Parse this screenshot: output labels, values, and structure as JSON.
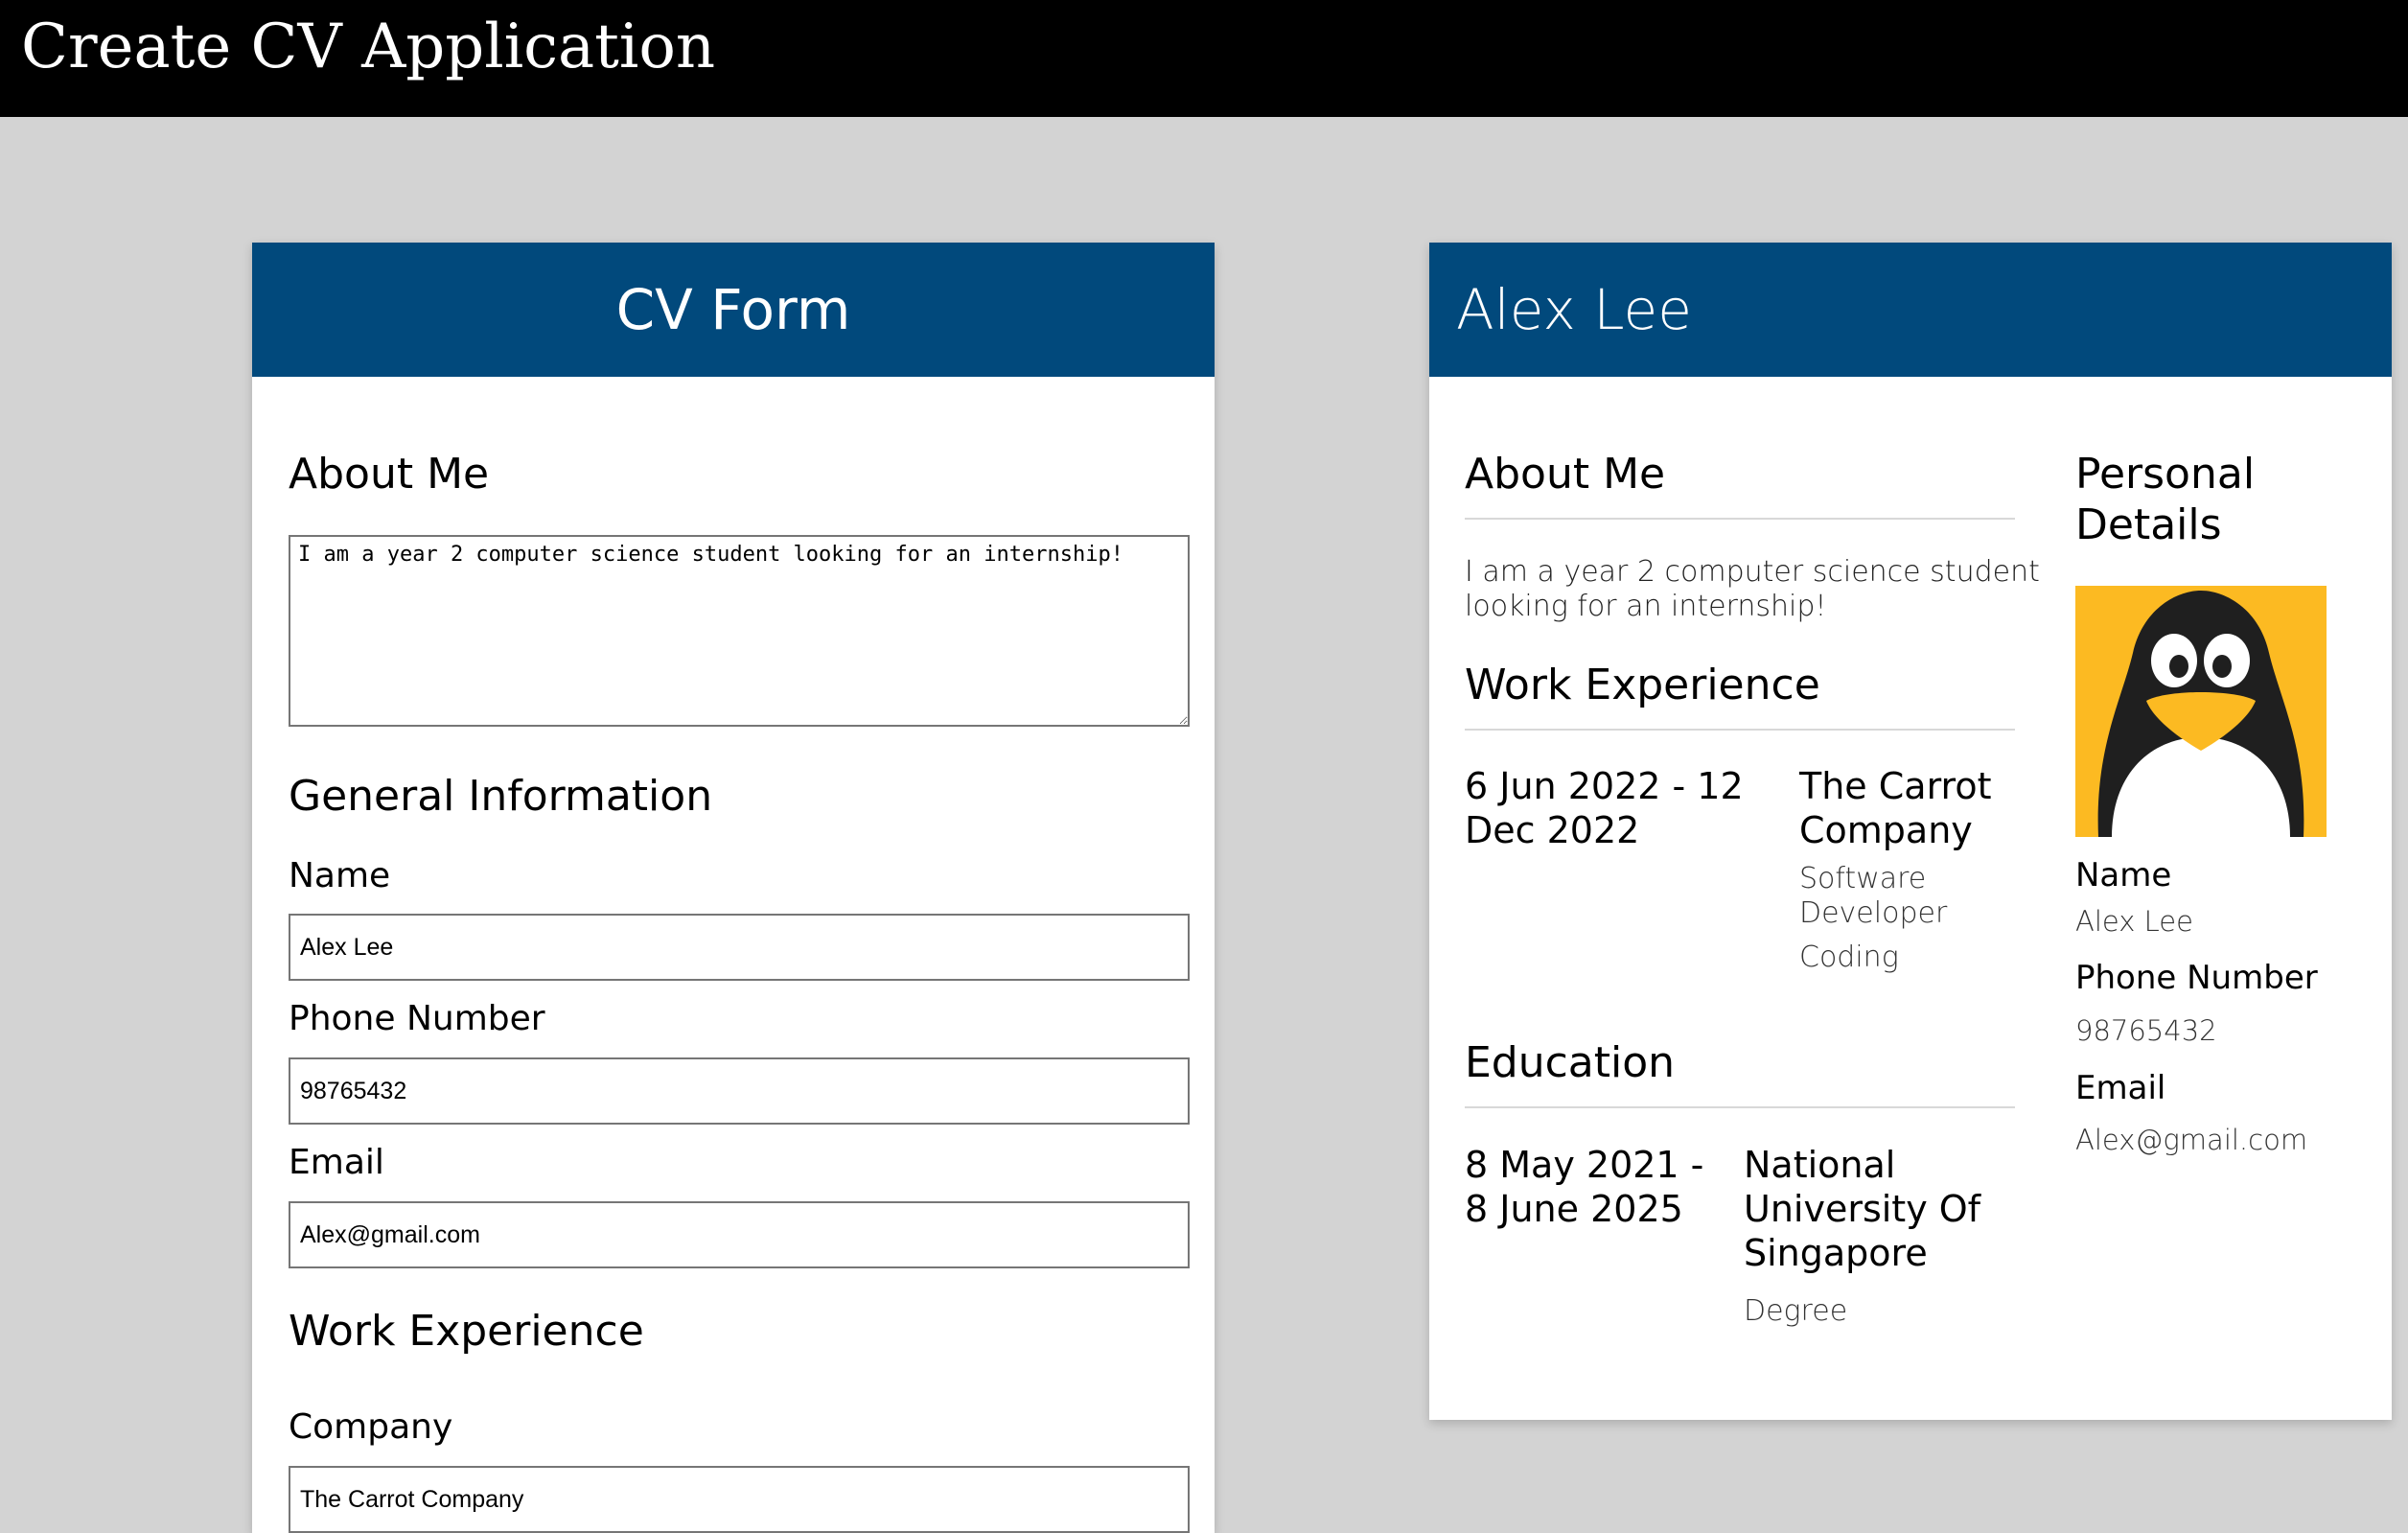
{
  "app": {
    "title": "Create CV Application"
  },
  "form": {
    "header": "CV Form",
    "about_heading": "About Me",
    "about_value": "I am a year 2 computer science student looking for an internship!",
    "general_heading": "General Information",
    "name_label": "Name",
    "name_value": "Alex Lee",
    "phone_label": "Phone Number",
    "phone_value": "98765432",
    "email_label": "Email",
    "email_value": "Alex@gmail.com",
    "work_heading": "Work Experience",
    "company_label": "Company",
    "company_value": "The Carrot Company"
  },
  "cv": {
    "name": "Alex Lee",
    "about_heading": "About Me",
    "about_text_line1": "I am a year 2 computer science student",
    "about_text_line2": "looking for an internship!",
    "work_heading": "Work Experience",
    "work": {
      "date_line1": "6 Jun 2022 - 12",
      "date_line2": "Dec 2022",
      "company_line1": "The Carrot",
      "company_line2": "Company",
      "role_line1": "Software",
      "role_line2": "Developer",
      "description": "Coding"
    },
    "education_heading": "Education",
    "education": {
      "date_line1": "8 May 2021 -",
      "date_line2": "8 June 2025",
      "school_line1": "National",
      "school_line2": "University Of",
      "school_line3": "Singapore",
      "qualification": "Degree"
    },
    "personal_heading_line1": "Personal",
    "personal_heading_line2": "Details",
    "avatar_icon": "penguin-avatar-icon",
    "name_label": "Name",
    "name_value": "Alex Lee",
    "phone_label": "Phone Number",
    "phone_value": "98765432",
    "email_label": "Email",
    "email_value": "Alex@gmail.com"
  },
  "colors": {
    "header_blue": "#01497c",
    "background": "#d3d3d3",
    "topbar": "#000000",
    "avatar_bg": "#fcba22"
  }
}
